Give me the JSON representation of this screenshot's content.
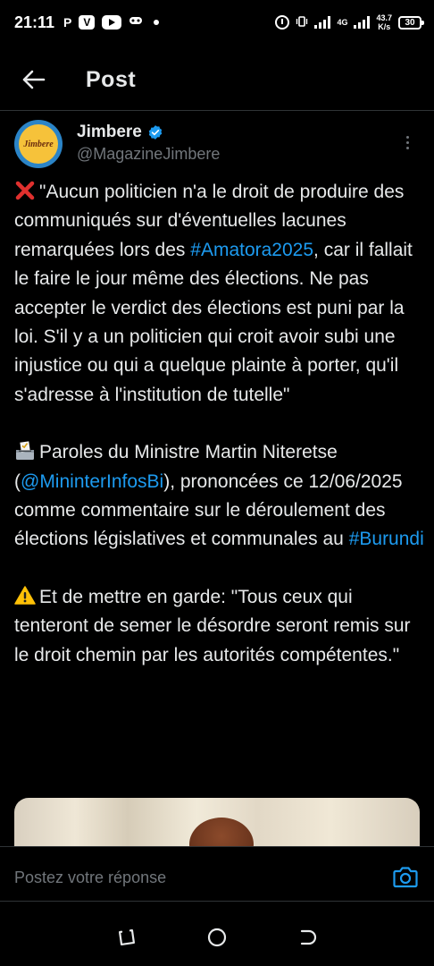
{
  "status_bar": {
    "time": "21:11",
    "notif_p": "P",
    "notif_v": "V",
    "network_type": "4G",
    "speed_value": "43.7",
    "speed_unit": "K/s",
    "battery": "30",
    "icons": [
      "pinterest-icon",
      "vpn-icon",
      "youtube-icon",
      "gamepad-icon",
      "alarm-icon",
      "vibrate-icon",
      "signal-icon",
      "battery-icon"
    ]
  },
  "header": {
    "title": "Post"
  },
  "author": {
    "name": "Jimbere",
    "handle": "@MagazineJimbere",
    "avatar_text": "Jimbere"
  },
  "tweet": {
    "p1_pre": "\"Aucun politicien n'a le droit de produire des communiqués sur d'éventuelles lacunes remarquées lors des ",
    "p1_link": "#Amatora2025",
    "p1_post": ", car il fallait le faire le jour même des élections. Ne pas accepter le verdict des élections est puni par la loi. S'il y a un politicien qui croit avoir subi une injustice ou qui a quelque plainte à porter, qu'il s'adresse à l'institution de tutelle\"",
    "p2_pre": "Paroles du Ministre Martin Niteretse (",
    "p2_link1": "@MininterInfosBi",
    "p2_mid": "), prononcées ce 12/06/2025 comme commentaire sur le déroulement des élections législatives et communales au ",
    "p2_link2": "#Burundi",
    "p3": "Et de mettre en garde: \"Tous ceux qui tenteront de semer le désordre seront remis sur le droit chemin par les autorités compétentes.\""
  },
  "reply": {
    "placeholder": "Postez votre réponse"
  },
  "colors": {
    "background": "#000000",
    "text": "#e7e9ea",
    "muted": "#71767b",
    "link": "#1d9bf0",
    "divider": "#2f3336"
  }
}
